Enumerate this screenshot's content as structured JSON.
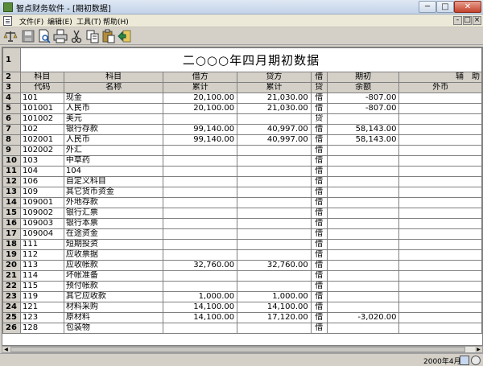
{
  "window": {
    "title": "智点财务软件 - [期初数据]",
    "min_glyph": "─",
    "max_glyph": "□",
    "close_glyph": "✕"
  },
  "menu": {
    "file": "文件(F)",
    "edit": "编辑(E)",
    "tools": "工具(T)",
    "help": "帮助(H)",
    "mdi_min": "-",
    "mdi_max": "□",
    "mdi_close": "×"
  },
  "toolbar": {
    "icons": [
      "balance-scale-icon",
      "save-icon",
      "print-preview-icon",
      "print-icon",
      "cut-icon",
      "copy-icon",
      "paste-icon",
      "exit-icon"
    ]
  },
  "sheet": {
    "title": "二○○○年四月期初数据",
    "headers": {
      "code_top": "科目",
      "code_bottom": "代码",
      "name_top": "科目",
      "name_bottom": "名称",
      "debit_top": "借方",
      "debit_bottom": "累计",
      "credit_top": "贷方",
      "credit_bottom": "累计",
      "dir_top": "借",
      "dir_bottom": "贷",
      "balance_top": "期初",
      "balance_bottom": "余额",
      "aux_top": "辅　助",
      "aux_bottom": "外币"
    },
    "row_numbers": [
      "1",
      "2",
      "3"
    ],
    "rows": [
      {
        "n": "4",
        "code": "101",
        "name": "现金",
        "debit": "20,100.00",
        "credit": "21,030.00",
        "dir": "借",
        "balance": "-807.00"
      },
      {
        "n": "5",
        "code": "101001",
        "name": "人民币",
        "debit": "20,100.00",
        "credit": "21,030.00",
        "dir": "借",
        "balance": "-807.00"
      },
      {
        "n": "6",
        "code": "101002",
        "name": "美元",
        "debit": "",
        "credit": "",
        "dir": "贷",
        "balance": ""
      },
      {
        "n": "7",
        "code": "102",
        "name": "银行存款",
        "debit": "99,140.00",
        "credit": "40,997.00",
        "dir": "借",
        "balance": "58,143.00"
      },
      {
        "n": "8",
        "code": "102001",
        "name": "人民币",
        "debit": "99,140.00",
        "credit": "40,997.00",
        "dir": "借",
        "balance": "58,143.00"
      },
      {
        "n": "9",
        "code": "102002",
        "name": "外汇",
        "debit": "",
        "credit": "",
        "dir": "借",
        "balance": ""
      },
      {
        "n": "10",
        "code": "103",
        "name": "中草药",
        "debit": "",
        "credit": "",
        "dir": "借",
        "balance": ""
      },
      {
        "n": "11",
        "code": "104",
        "name": "104",
        "debit": "",
        "credit": "",
        "dir": "借",
        "balance": ""
      },
      {
        "n": "12",
        "code": "106",
        "name": "自定义科目",
        "debit": "",
        "credit": "",
        "dir": "借",
        "balance": ""
      },
      {
        "n": "13",
        "code": "109",
        "name": "其它货币资金",
        "debit": "",
        "credit": "",
        "dir": "借",
        "balance": ""
      },
      {
        "n": "14",
        "code": "109001",
        "name": "外地存款",
        "debit": "",
        "credit": "",
        "dir": "借",
        "balance": ""
      },
      {
        "n": "15",
        "code": "109002",
        "name": "银行汇票",
        "debit": "",
        "credit": "",
        "dir": "借",
        "balance": ""
      },
      {
        "n": "16",
        "code": "109003",
        "name": "银行本票",
        "debit": "",
        "credit": "",
        "dir": "借",
        "balance": ""
      },
      {
        "n": "17",
        "code": "109004",
        "name": "在途资金",
        "debit": "",
        "credit": "",
        "dir": "借",
        "balance": ""
      },
      {
        "n": "18",
        "code": "111",
        "name": "短期投资",
        "debit": "",
        "credit": "",
        "dir": "借",
        "balance": ""
      },
      {
        "n": "19",
        "code": "112",
        "name": "应收票据",
        "debit": "",
        "credit": "",
        "dir": "借",
        "balance": ""
      },
      {
        "n": "20",
        "code": "113",
        "name": "应收帐款",
        "debit": "32,760.00",
        "credit": "32,760.00",
        "dir": "借",
        "balance": ""
      },
      {
        "n": "21",
        "code": "114",
        "name": "坏帐准备",
        "debit": "",
        "credit": "",
        "dir": "借",
        "balance": ""
      },
      {
        "n": "22",
        "code": "115",
        "name": "预付帐款",
        "debit": "",
        "credit": "",
        "dir": "借",
        "balance": ""
      },
      {
        "n": "23",
        "code": "119",
        "name": "其它应收款",
        "debit": "1,000.00",
        "credit": "1,000.00",
        "dir": "借",
        "balance": ""
      },
      {
        "n": "24",
        "code": "121",
        "name": "材料采购",
        "debit": "14,100.00",
        "credit": "14,100.00",
        "dir": "借",
        "balance": ""
      },
      {
        "n": "25",
        "code": "123",
        "name": "原材料",
        "debit": "14,100.00",
        "credit": "17,120.00",
        "dir": "借",
        "balance": "-3,020.00"
      },
      {
        "n": "26",
        "code": "128",
        "name": "包装物",
        "debit": "",
        "credit": "",
        "dir": "借",
        "balance": ""
      }
    ]
  },
  "scrollbar": {
    "left_glyph": "◀",
    "right_glyph": "▶"
  },
  "status": {
    "date": "2000年4月"
  }
}
